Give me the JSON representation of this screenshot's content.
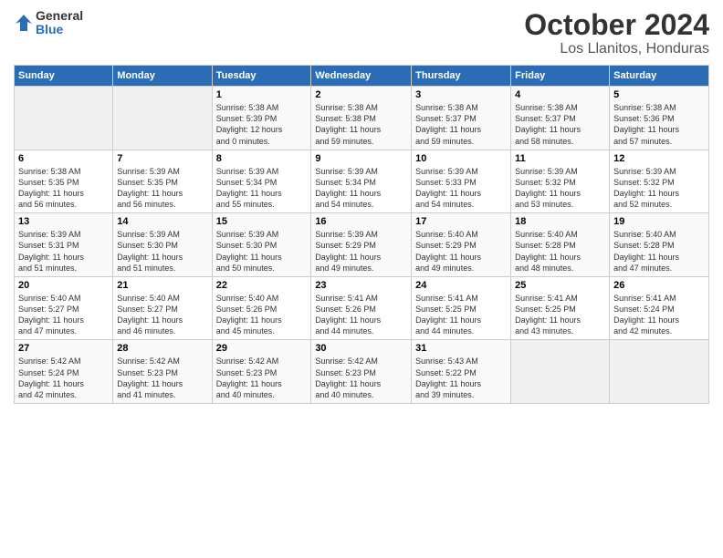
{
  "logo": {
    "line1": "General",
    "line2": "Blue"
  },
  "title": "October 2024",
  "subtitle": "Los Llanitos, Honduras",
  "days_of_week": [
    "Sunday",
    "Monday",
    "Tuesday",
    "Wednesday",
    "Thursday",
    "Friday",
    "Saturday"
  ],
  "weeks": [
    [
      {
        "day": "",
        "detail": ""
      },
      {
        "day": "",
        "detail": ""
      },
      {
        "day": "1",
        "detail": "Sunrise: 5:38 AM\nSunset: 5:39 PM\nDaylight: 12 hours\nand 0 minutes."
      },
      {
        "day": "2",
        "detail": "Sunrise: 5:38 AM\nSunset: 5:38 PM\nDaylight: 11 hours\nand 59 minutes."
      },
      {
        "day": "3",
        "detail": "Sunrise: 5:38 AM\nSunset: 5:37 PM\nDaylight: 11 hours\nand 59 minutes."
      },
      {
        "day": "4",
        "detail": "Sunrise: 5:38 AM\nSunset: 5:37 PM\nDaylight: 11 hours\nand 58 minutes."
      },
      {
        "day": "5",
        "detail": "Sunrise: 5:38 AM\nSunset: 5:36 PM\nDaylight: 11 hours\nand 57 minutes."
      }
    ],
    [
      {
        "day": "6",
        "detail": "Sunrise: 5:38 AM\nSunset: 5:35 PM\nDaylight: 11 hours\nand 56 minutes."
      },
      {
        "day": "7",
        "detail": "Sunrise: 5:39 AM\nSunset: 5:35 PM\nDaylight: 11 hours\nand 56 minutes."
      },
      {
        "day": "8",
        "detail": "Sunrise: 5:39 AM\nSunset: 5:34 PM\nDaylight: 11 hours\nand 55 minutes."
      },
      {
        "day": "9",
        "detail": "Sunrise: 5:39 AM\nSunset: 5:34 PM\nDaylight: 11 hours\nand 54 minutes."
      },
      {
        "day": "10",
        "detail": "Sunrise: 5:39 AM\nSunset: 5:33 PM\nDaylight: 11 hours\nand 54 minutes."
      },
      {
        "day": "11",
        "detail": "Sunrise: 5:39 AM\nSunset: 5:32 PM\nDaylight: 11 hours\nand 53 minutes."
      },
      {
        "day": "12",
        "detail": "Sunrise: 5:39 AM\nSunset: 5:32 PM\nDaylight: 11 hours\nand 52 minutes."
      }
    ],
    [
      {
        "day": "13",
        "detail": "Sunrise: 5:39 AM\nSunset: 5:31 PM\nDaylight: 11 hours\nand 51 minutes."
      },
      {
        "day": "14",
        "detail": "Sunrise: 5:39 AM\nSunset: 5:30 PM\nDaylight: 11 hours\nand 51 minutes."
      },
      {
        "day": "15",
        "detail": "Sunrise: 5:39 AM\nSunset: 5:30 PM\nDaylight: 11 hours\nand 50 minutes."
      },
      {
        "day": "16",
        "detail": "Sunrise: 5:39 AM\nSunset: 5:29 PM\nDaylight: 11 hours\nand 49 minutes."
      },
      {
        "day": "17",
        "detail": "Sunrise: 5:40 AM\nSunset: 5:29 PM\nDaylight: 11 hours\nand 49 minutes."
      },
      {
        "day": "18",
        "detail": "Sunrise: 5:40 AM\nSunset: 5:28 PM\nDaylight: 11 hours\nand 48 minutes."
      },
      {
        "day": "19",
        "detail": "Sunrise: 5:40 AM\nSunset: 5:28 PM\nDaylight: 11 hours\nand 47 minutes."
      }
    ],
    [
      {
        "day": "20",
        "detail": "Sunrise: 5:40 AM\nSunset: 5:27 PM\nDaylight: 11 hours\nand 47 minutes."
      },
      {
        "day": "21",
        "detail": "Sunrise: 5:40 AM\nSunset: 5:27 PM\nDaylight: 11 hours\nand 46 minutes."
      },
      {
        "day": "22",
        "detail": "Sunrise: 5:40 AM\nSunset: 5:26 PM\nDaylight: 11 hours\nand 45 minutes."
      },
      {
        "day": "23",
        "detail": "Sunrise: 5:41 AM\nSunset: 5:26 PM\nDaylight: 11 hours\nand 44 minutes."
      },
      {
        "day": "24",
        "detail": "Sunrise: 5:41 AM\nSunset: 5:25 PM\nDaylight: 11 hours\nand 44 minutes."
      },
      {
        "day": "25",
        "detail": "Sunrise: 5:41 AM\nSunset: 5:25 PM\nDaylight: 11 hours\nand 43 minutes."
      },
      {
        "day": "26",
        "detail": "Sunrise: 5:41 AM\nSunset: 5:24 PM\nDaylight: 11 hours\nand 42 minutes."
      }
    ],
    [
      {
        "day": "27",
        "detail": "Sunrise: 5:42 AM\nSunset: 5:24 PM\nDaylight: 11 hours\nand 42 minutes."
      },
      {
        "day": "28",
        "detail": "Sunrise: 5:42 AM\nSunset: 5:23 PM\nDaylight: 11 hours\nand 41 minutes."
      },
      {
        "day": "29",
        "detail": "Sunrise: 5:42 AM\nSunset: 5:23 PM\nDaylight: 11 hours\nand 40 minutes."
      },
      {
        "day": "30",
        "detail": "Sunrise: 5:42 AM\nSunset: 5:23 PM\nDaylight: 11 hours\nand 40 minutes."
      },
      {
        "day": "31",
        "detail": "Sunrise: 5:43 AM\nSunset: 5:22 PM\nDaylight: 11 hours\nand 39 minutes."
      },
      {
        "day": "",
        "detail": ""
      },
      {
        "day": "",
        "detail": ""
      }
    ]
  ]
}
